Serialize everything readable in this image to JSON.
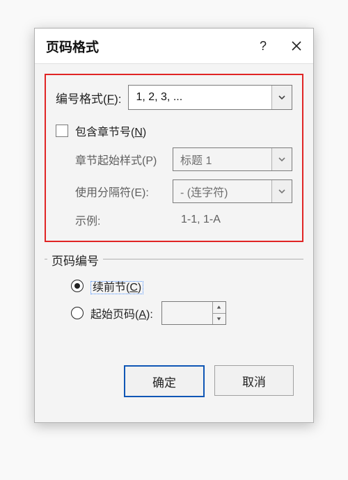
{
  "titlebar": {
    "title": "页码格式",
    "help": "?"
  },
  "highlight": {
    "format_label_pre": "编号格式(",
    "format_access": "F",
    "format_label_post": "):",
    "format_value": "1, 2, 3, ...",
    "include_chapter_pre": "包含章节号(",
    "include_chapter_access": "N",
    "include_chapter_post": ")",
    "chapter_style_label": "章节起始样式(P)",
    "chapter_style_value": "标题 1",
    "separator_label": "使用分隔符(E):",
    "separator_value": "-  (连字符)",
    "example_label": "示例:",
    "example_value": "1-1, 1-A"
  },
  "group": {
    "label": "页码编号",
    "continue_pre": "续前节(",
    "continue_access": "C",
    "continue_post": ")",
    "start_pre": "起始页码(",
    "start_access": "A",
    "start_post": "):",
    "start_value": ""
  },
  "actions": {
    "ok": "确定",
    "cancel": "取消"
  }
}
